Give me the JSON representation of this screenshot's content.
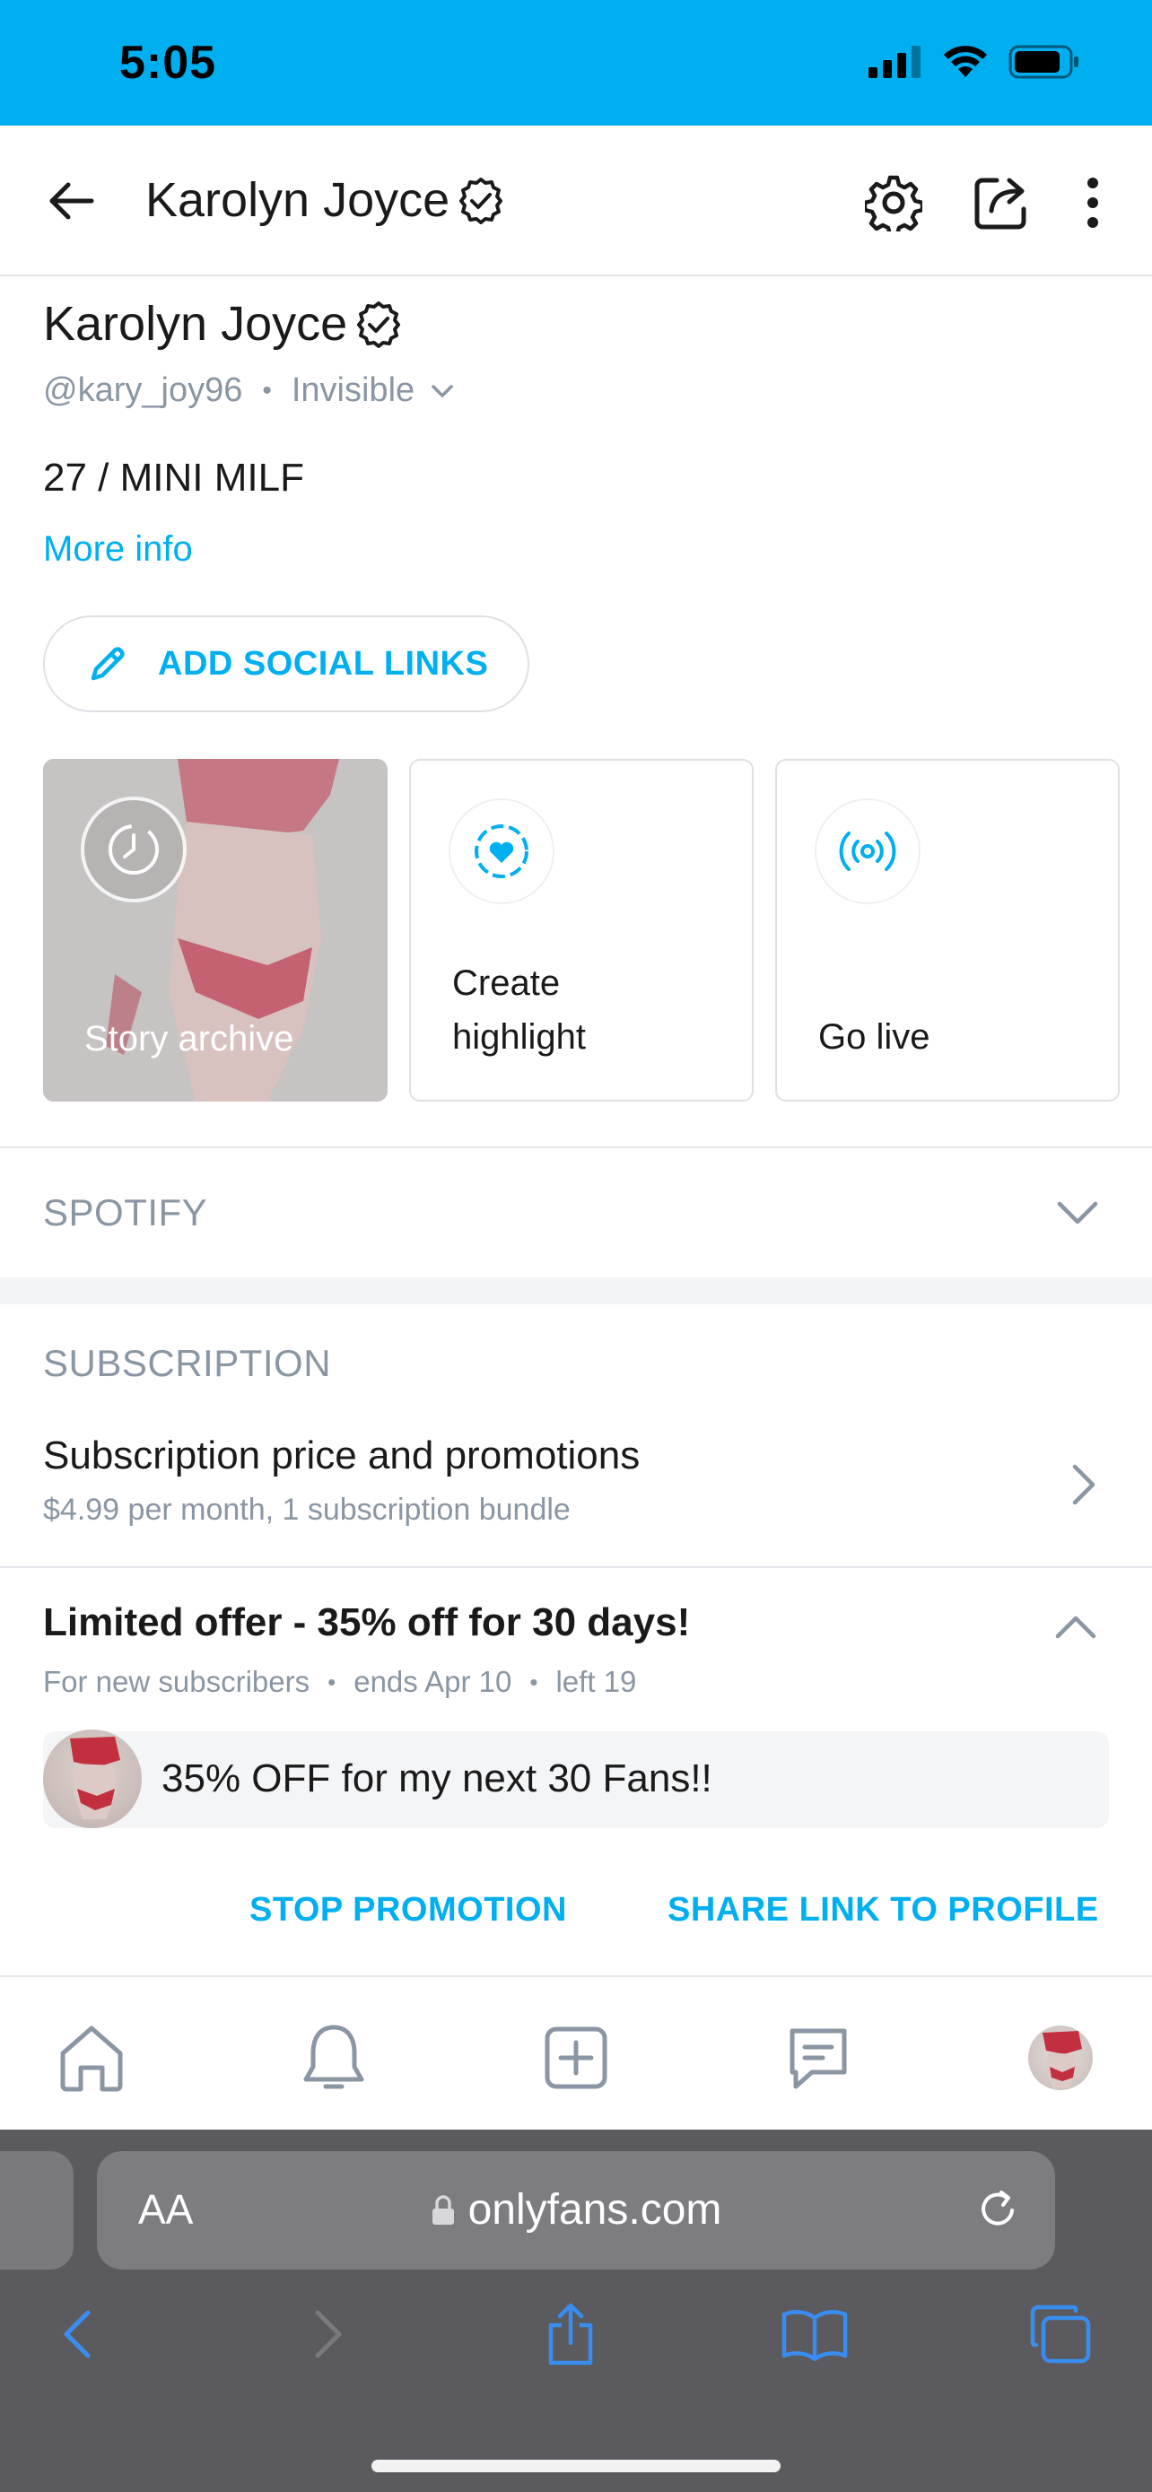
{
  "status_bar": {
    "time": "5:05"
  },
  "header": {
    "title": "Karolyn Joyce"
  },
  "profile": {
    "name": "Karolyn Joyce",
    "username": "@kary_joy96",
    "status": "Invisible",
    "bio": "27 / MINI MILF",
    "more_info": "More info",
    "add_social_links": "ADD SOCIAL LINKS"
  },
  "cards": {
    "story_archive": "Story archive",
    "create_highlight_line1": "Create",
    "create_highlight_line2": "highlight",
    "go_live": "Go live"
  },
  "spotify": {
    "label": "SPOTIFY"
  },
  "subscription": {
    "label": "SUBSCRIPTION",
    "row_title": "Subscription price and promotions",
    "row_detail": "$4.99 per month, 1 subscription bundle"
  },
  "offer": {
    "title": "Limited offer - 35% off for 30 days!",
    "audience": "For new subscribers",
    "ends": "ends Apr 10",
    "left": "left 19",
    "promo_message": "35% OFF for my next 30 Fans!!",
    "stop_promotion": "STOP PROMOTION",
    "share_link": "SHARE LINK TO PROFILE"
  },
  "browser": {
    "text_size": "AA",
    "url": "onlyfans.com"
  },
  "colors": {
    "accent": "#00aff0",
    "status_bar": "#00aff0",
    "muted_text": "#8a96a3",
    "safari_bar": "#5b5b5f"
  },
  "icons": [
    "back-arrow-icon",
    "verified-icon",
    "gear-icon",
    "share-icon",
    "more-icon",
    "pencil-icon",
    "clock-icon",
    "heart-icon",
    "broadcast-icon",
    "chevron-down-icon",
    "chevron-right-icon",
    "chevron-up-icon",
    "home-icon",
    "bell-icon",
    "plus-square-icon",
    "message-icon",
    "lock-icon",
    "reload-icon",
    "safari-back-icon",
    "safari-forward-icon",
    "safari-share-icon",
    "bookmarks-icon",
    "tabs-icon"
  ]
}
